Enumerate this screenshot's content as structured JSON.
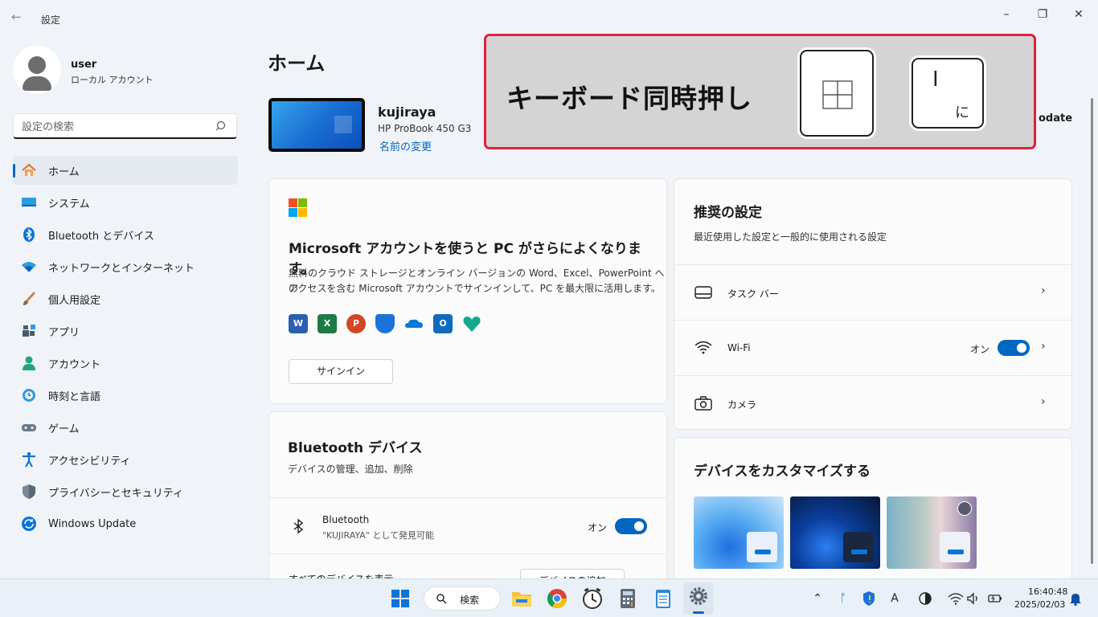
{
  "window": {
    "title": "設定"
  },
  "user": {
    "name": "user",
    "account_type": "ローカル アカウント"
  },
  "search": {
    "placeholder": "設定の検索"
  },
  "sidebar": {
    "items": [
      {
        "label": "ホーム",
        "icon": "home-icon"
      },
      {
        "label": "システム",
        "icon": "system-icon"
      },
      {
        "label": "Bluetooth とデバイス",
        "icon": "bluetooth-icon"
      },
      {
        "label": "ネットワークとインターネット",
        "icon": "network-icon"
      },
      {
        "label": "個人用設定",
        "icon": "brush-icon"
      },
      {
        "label": "アプリ",
        "icon": "apps-icon"
      },
      {
        "label": "アカウント",
        "icon": "account-icon"
      },
      {
        "label": "時刻と言語",
        "icon": "time-language-icon"
      },
      {
        "label": "ゲーム",
        "icon": "game-icon"
      },
      {
        "label": "アクセシビリティ",
        "icon": "accessibility-icon"
      },
      {
        "label": "プライバシーとセキュリティ",
        "icon": "shield-icon"
      },
      {
        "label": "Windows Update",
        "icon": "update-icon"
      }
    ]
  },
  "main": {
    "title": "ホーム",
    "device": {
      "name": "kujiraya",
      "model": "HP ProBook 450 G3",
      "rename_link": "名前の変更"
    },
    "windows_update_label": "odate",
    "ms_card": {
      "heading": "Microsoft アカウントを使うと PC がさらによくなります。",
      "description_line1": "無料のクラウド ストレージとオンライン バージョンの Word、Excel、PowerPoint への",
      "description_line2": "アクセスを含む Microsoft アカウントでサインインして、PC を最大限に活用します。",
      "signin_button": "サインイン",
      "apps": [
        "word-icon",
        "excel-icon",
        "powerpoint-icon",
        "defender-icon",
        "onedrive-icon",
        "outlook-icon",
        "family-icon"
      ]
    },
    "bt_card": {
      "heading": "Bluetooth デバイス",
      "subheading": "デバイスの管理、追加、削除",
      "bluetooth_label": "Bluetooth",
      "bluetooth_sub": "\"KUJIRAYA\" として発見可能",
      "toggle_text": "オン",
      "bottom_row_label": "すべてのデバイスを表示",
      "bottom_row_button": "デバイスの追加"
    },
    "recommended": {
      "heading": "推奨の設定",
      "subheading": "最近使用した設定と一般的に使用される設定",
      "rows": [
        {
          "label": "タスク バー",
          "icon": "taskbar-icon"
        },
        {
          "label": "Wi-Fi",
          "icon": "wifi-icon",
          "toggle_text": "オン"
        },
        {
          "label": "カメラ",
          "icon": "camera-icon"
        }
      ]
    },
    "customize": {
      "heading": "デバイスをカスタマイズする"
    }
  },
  "overlay": {
    "text": "キーボード同時押し",
    "key2_main": "I",
    "key2_kana": "に"
  },
  "taskbar": {
    "search_label": "検索",
    "time": "16:40:48",
    "date": "2025/02/03"
  },
  "colors": {
    "accent": "#0067c0",
    "overlay_border": "#e0213c"
  }
}
